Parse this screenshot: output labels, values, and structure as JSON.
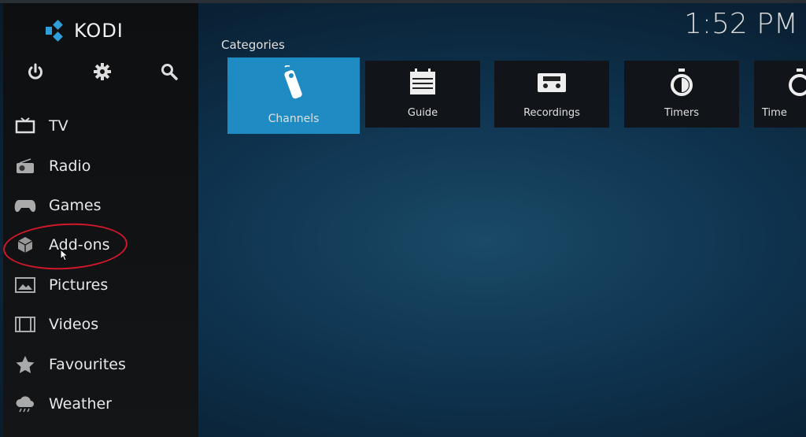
{
  "app": {
    "name": "KODI",
    "clock": "1:52 PM"
  },
  "colors": {
    "accent": "#1e8bc3",
    "sidebar": "#111315",
    "annotation": "#d0182a"
  },
  "top_icons": [
    "power-icon",
    "settings-icon",
    "search-icon"
  ],
  "sidebar": {
    "items": [
      {
        "label": "TV",
        "icon": "tv-icon"
      },
      {
        "label": "Radio",
        "icon": "radio-icon"
      },
      {
        "label": "Games",
        "icon": "gamepad-icon"
      },
      {
        "label": "Add-ons",
        "icon": "box-icon"
      },
      {
        "label": "Pictures",
        "icon": "picture-icon"
      },
      {
        "label": "Videos",
        "icon": "film-icon"
      },
      {
        "label": "Favourites",
        "icon": "star-icon"
      },
      {
        "label": "Weather",
        "icon": "weather-icon"
      }
    ]
  },
  "main": {
    "section_title": "Categories",
    "tiles": [
      {
        "label": "Channels",
        "icon": "remote-icon",
        "selected": true
      },
      {
        "label": "Guide",
        "icon": "calendar-icon"
      },
      {
        "label": "Recordings",
        "icon": "cassette-icon"
      },
      {
        "label": "Timers",
        "icon": "stopwatch-icon"
      },
      {
        "label": "Time",
        "icon": "stopwatch-icon"
      }
    ]
  }
}
